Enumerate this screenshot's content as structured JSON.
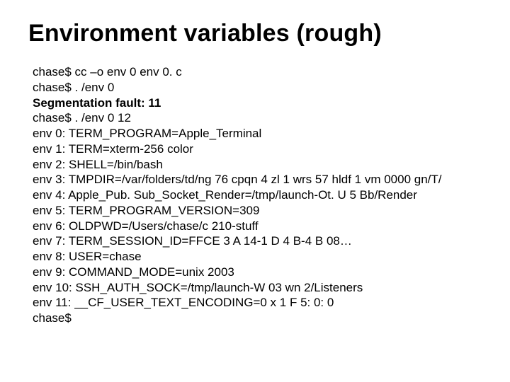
{
  "title": "Environment variables (rough)",
  "lines": [
    {
      "text": "chase$ cc –o env 0 env 0. c",
      "bold": false
    },
    {
      "text": "chase$ . /env 0",
      "bold": false
    },
    {
      "text": "Segmentation fault: 11",
      "bold": true
    },
    {
      "text": "chase$ . /env 0 12",
      "bold": false
    },
    {
      "text": "env 0: TERM_PROGRAM=Apple_Terminal",
      "bold": false
    },
    {
      "text": "env 1: TERM=xterm-256 color",
      "bold": false
    },
    {
      "text": "env 2: SHELL=/bin/bash",
      "bold": false
    },
    {
      "text": "env 3: TMPDIR=/var/folders/td/ng 76 cpqn 4 zl 1 wrs 57 hldf 1 vm 0000 gn/T/",
      "bold": false
    },
    {
      "text": "env 4: Apple_Pub. Sub_Socket_Render=/tmp/launch-Ot. U 5 Bb/Render",
      "bold": false
    },
    {
      "text": "env 5: TERM_PROGRAM_VERSION=309",
      "bold": false
    },
    {
      "text": "env 6: OLDPWD=/Users/chase/c 210-stuff",
      "bold": false
    },
    {
      "text": "env 7: TERM_SESSION_ID=FFCE 3 A 14-1 D 4 B-4 B 08…",
      "bold": false
    },
    {
      "text": "env 8: USER=chase",
      "bold": false
    },
    {
      "text": "env 9: COMMAND_MODE=unix 2003",
      "bold": false
    },
    {
      "text": "env 10: SSH_AUTH_SOCK=/tmp/launch-W 03 wn 2/Listeners",
      "bold": false
    },
    {
      "text": "env 11: __CF_USER_TEXT_ENCODING=0 x 1 F 5: 0: 0",
      "bold": false
    },
    {
      "text": "chase$",
      "bold": false
    }
  ]
}
